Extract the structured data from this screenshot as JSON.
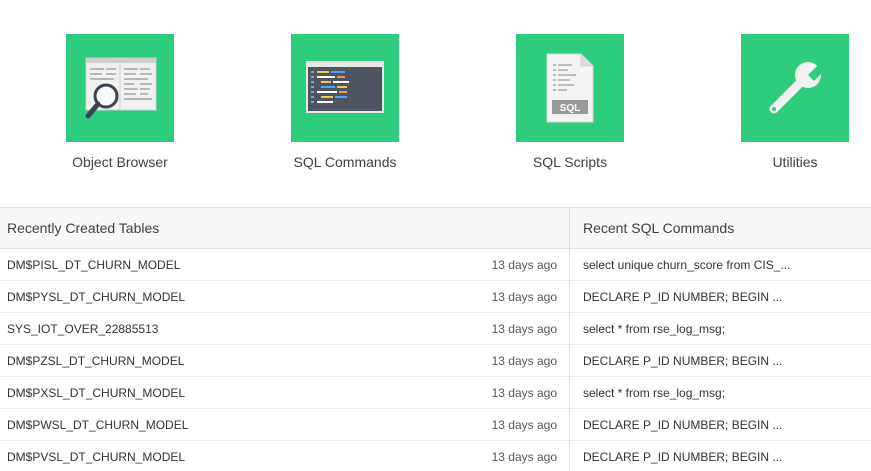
{
  "tiles": [
    {
      "label": "Object Browser",
      "icon": "object-browser-icon"
    },
    {
      "label": "SQL Commands",
      "icon": "sql-commands-icon"
    },
    {
      "label": "SQL Scripts",
      "icon": "sql-scripts-icon",
      "badge": "SQL"
    },
    {
      "label": "Utilities",
      "icon": "wrench-icon"
    }
  ],
  "colors": {
    "tile_bg": "#2ecd7e"
  },
  "recent_tables": {
    "title": "Recently Created Tables",
    "rows": [
      {
        "name": "DM$PISL_DT_CHURN_MODEL",
        "time": "13 days ago"
      },
      {
        "name": "DM$PYSL_DT_CHURN_MODEL",
        "time": "13 days ago"
      },
      {
        "name": "SYS_IOT_OVER_22885513",
        "time": "13 days ago"
      },
      {
        "name": "DM$PZSL_DT_CHURN_MODEL",
        "time": "13 days ago"
      },
      {
        "name": "DM$PXSL_DT_CHURN_MODEL",
        "time": "13 days ago"
      },
      {
        "name": "DM$PWSL_DT_CHURN_MODEL",
        "time": "13 days ago"
      },
      {
        "name": "DM$PVSL_DT_CHURN_MODEL",
        "time": "13 days ago"
      }
    ]
  },
  "recent_sql": {
    "title": "Recent SQL Commands",
    "rows": [
      {
        "text": "select unique churn_score from CIS_..."
      },
      {
        "text": "DECLARE P_ID NUMBER; BEGIN ..."
      },
      {
        "text": "select * from rse_log_msg;"
      },
      {
        "text": "DECLARE P_ID NUMBER; BEGIN ..."
      },
      {
        "text": "select * from rse_log_msg;"
      },
      {
        "text": "DECLARE P_ID NUMBER; BEGIN ..."
      },
      {
        "text": "DECLARE P_ID NUMBER; BEGIN ..."
      }
    ]
  }
}
